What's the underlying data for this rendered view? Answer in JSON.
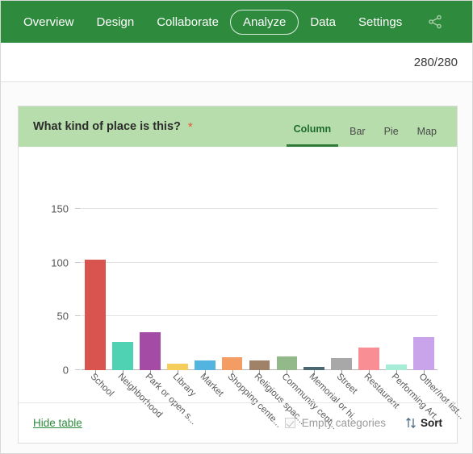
{
  "topnav": {
    "items": [
      {
        "label": "Overview",
        "active": false
      },
      {
        "label": "Design",
        "active": false
      },
      {
        "label": "Collaborate",
        "active": false
      },
      {
        "label": "Analyze",
        "active": true
      },
      {
        "label": "Data",
        "active": false
      },
      {
        "label": "Settings",
        "active": false
      }
    ],
    "share_icon": "share-icon",
    "background": "#2e8b3d"
  },
  "countbar": {
    "count": "280/280"
  },
  "card": {
    "question": "What kind of place is this?",
    "required_marker": "*",
    "header_background": "#b6ddab",
    "chart_tabs": [
      {
        "label": "Column",
        "active": true
      },
      {
        "label": "Bar",
        "active": false
      },
      {
        "label": "Pie",
        "active": false
      },
      {
        "label": "Map",
        "active": false
      }
    ],
    "footer": {
      "hide_table": "Hide table",
      "empty_categories": "Empty categories",
      "empty_categories_checked": true,
      "sort": "Sort",
      "sort_icon": "sort-arrows-icon"
    }
  },
  "chart_data": {
    "type": "bar",
    "title": "What kind of place is this?",
    "xlabel": "",
    "ylabel": "",
    "ylim": [
      0,
      150
    ],
    "yticks": [
      0,
      50,
      100,
      150
    ],
    "grid": true,
    "legend": false,
    "categories": [
      "School",
      "Neighborhood",
      "Park or open s...",
      "Library",
      "Market",
      "Shopping cente...",
      "Religious spac...",
      "Community cent...",
      "Memorial or hi...",
      "Street",
      "Restaurant",
      "Performing Art...",
      "Other/not list..."
    ],
    "values": [
      103,
      26,
      35,
      6,
      9,
      12,
      9,
      13,
      3,
      11,
      21,
      5,
      31
    ],
    "colors": [
      "#d9534f",
      "#4fd1b4",
      "#a34ba5",
      "#f6cd5b",
      "#54b4e0",
      "#f39c63",
      "#a08268",
      "#93b98a",
      "#4a6872",
      "#a8a8a8",
      "#f98e95",
      "#a6ecd7",
      "#c9a4ea"
    ]
  }
}
